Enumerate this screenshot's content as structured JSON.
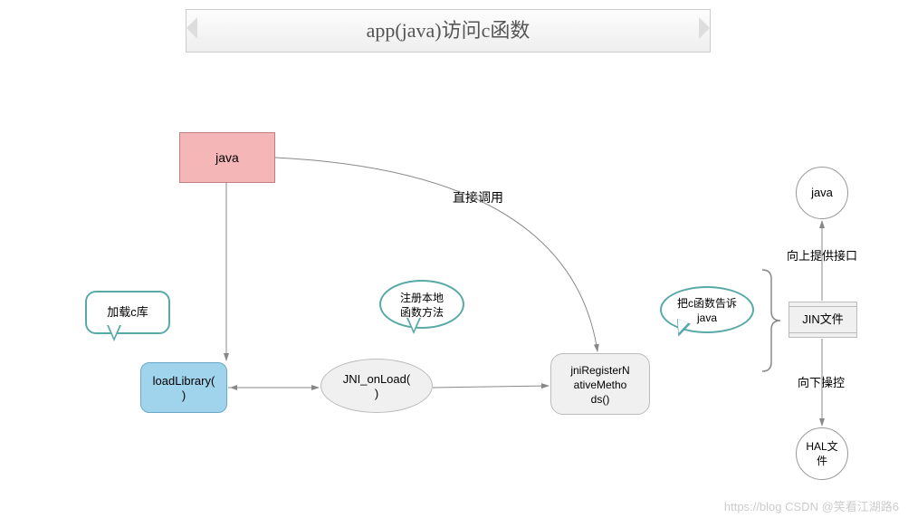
{
  "title": "app(java)访问c函数",
  "nodes": {
    "java": "java",
    "loadLibrary": "loadLibrary( )",
    "jniOnLoad": "JNI_onLoad( )",
    "jniRegister": "jniRegisterN ativeMetho ds()",
    "java2": "java",
    "jin": "JIN文件",
    "hal": "HAL文 件"
  },
  "callouts": {
    "loadC": "加载c库",
    "register": "注册本地 函数方法",
    "tellJava": "把c函数告诉 java"
  },
  "labels": {
    "directCall": "直接调用",
    "provideUp": "向上提供接口",
    "controlDown": "向下操控"
  },
  "watermark": "https://blog CSDN @笑看江湖路6"
}
